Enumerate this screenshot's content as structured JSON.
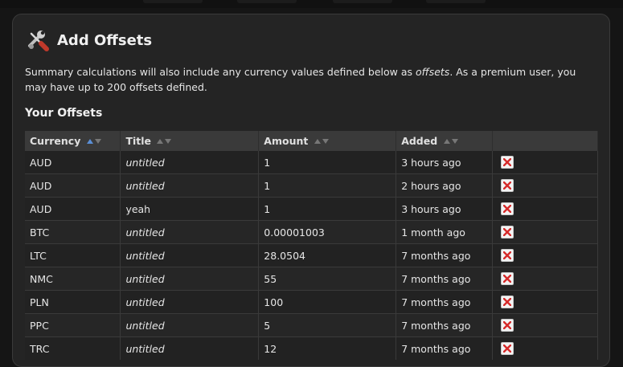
{
  "panel": {
    "title": "Add Offsets",
    "icon": "tools-icon",
    "intro_before": "Summary calculations will also include any currency values defined below as ",
    "intro_em": "offsets",
    "intro_after": ". As a premium user, you may have up to 200 offsets defined.",
    "subhead": "Your Offsets"
  },
  "table": {
    "columns": [
      "Currency",
      "Title",
      "Amount",
      "Added"
    ],
    "active_sort_column": "Currency",
    "rows": [
      {
        "currency": "AUD",
        "title": "untitled",
        "title_italic": true,
        "amount": "1",
        "added": "3 hours ago"
      },
      {
        "currency": "AUD",
        "title": "untitled",
        "title_italic": true,
        "amount": "1",
        "added": "2 hours ago"
      },
      {
        "currency": "AUD",
        "title": "yeah",
        "title_italic": false,
        "amount": "1",
        "added": "3 hours ago"
      },
      {
        "currency": "BTC",
        "title": "untitled",
        "title_italic": true,
        "amount": "0.00001003",
        "added": "1 month ago"
      },
      {
        "currency": "LTC",
        "title": "untitled",
        "title_italic": true,
        "amount": "28.0504",
        "added": "7 months ago"
      },
      {
        "currency": "NMC",
        "title": "untitled",
        "title_italic": true,
        "amount": "55",
        "added": "7 months ago"
      },
      {
        "currency": "PLN",
        "title": "untitled",
        "title_italic": true,
        "amount": "100",
        "added": "7 months ago"
      },
      {
        "currency": "PPC",
        "title": "untitled",
        "title_italic": true,
        "amount": "5",
        "added": "7 months ago"
      },
      {
        "currency": "TRC",
        "title": "untitled",
        "title_italic": true,
        "amount": "12",
        "added": "7 months ago"
      }
    ]
  },
  "colors": {
    "background": "#151515",
    "panel": "#242424",
    "header_row": "#3a3a3a",
    "sort_active": "#5b8fd6",
    "delete_x": "#d62b2b"
  }
}
